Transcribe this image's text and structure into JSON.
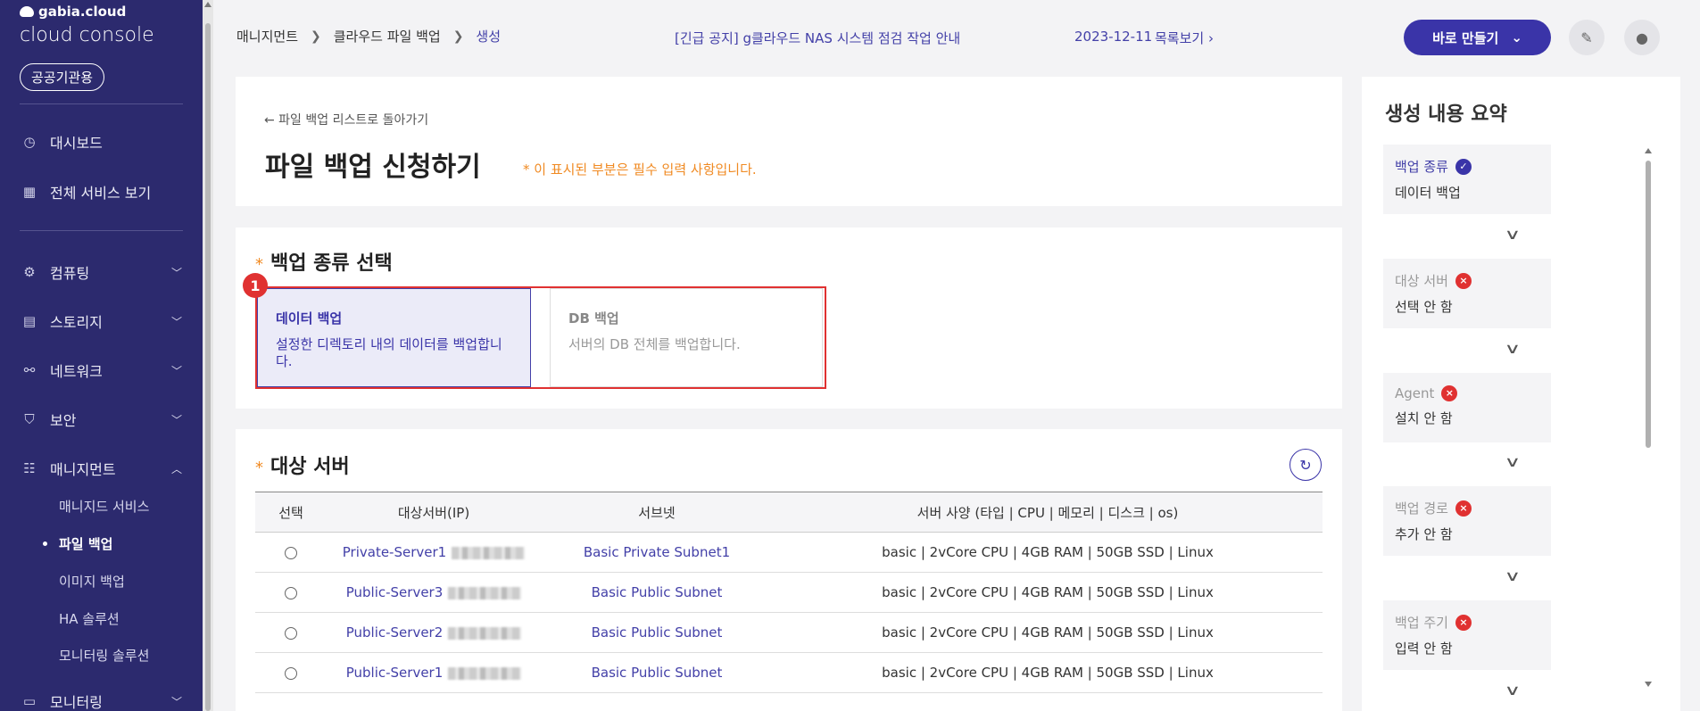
{
  "sidebar": {
    "brand_small": "gabia.cloud",
    "brand_big": "cloud console",
    "public_label": "공공기관용",
    "items": [
      {
        "label": "대시보드",
        "icon": "dashboard-icon"
      },
      {
        "label": "전체 서비스 보기",
        "icon": "grid-icon"
      },
      {
        "label": "컴퓨팅",
        "icon": "cpu-icon"
      },
      {
        "label": "스토리지",
        "icon": "storage-icon"
      },
      {
        "label": "네트워크",
        "icon": "network-icon"
      },
      {
        "label": "보안",
        "icon": "shield-icon"
      },
      {
        "label": "매니지먼트",
        "icon": "management-icon"
      },
      {
        "label": "모니터링",
        "icon": "monitor-icon"
      }
    ],
    "sub_items": [
      "매니지드 서비스",
      "파일 백업",
      "이미지 백업",
      "HA 솔루션",
      "모니터링 솔루션"
    ]
  },
  "header": {
    "breadcrumb": [
      "매니지먼트",
      "클라우드 파일 백업",
      "생성"
    ],
    "notice": "[긴급 공지] g클라우드 NAS 시스템 점검 작업 안내",
    "notice_date": "2023-12-11",
    "notice_list": "목록보기",
    "quick_create": "바로 만들기"
  },
  "page": {
    "back_link": "← 파일 백업 리스트로 돌아가기",
    "title": "파일 백업 신청하기",
    "required_note": "* 이 표시된 부분은 필수 입력 사항입니다."
  },
  "backup_type": {
    "title": "백업 종류 선택",
    "badge": "1",
    "options": [
      {
        "title": "데이터 백업",
        "desc": "설정한 디렉토리 내의 데이터를 백업합니다."
      },
      {
        "title": "DB 백업",
        "desc": "서버의 DB 전체를 백업합니다."
      }
    ]
  },
  "target_server": {
    "title": "대상 서버",
    "columns": [
      "선택",
      "대상서버(IP)",
      "서브넷",
      "서버 사양 (타입 | CPU | 메모리 | 디스크 | os)"
    ],
    "rows": [
      {
        "server": "Private-Server1",
        "subnet": "Basic Private Subnet1",
        "spec": "basic | 2vCore CPU | 4GB RAM | 50GB SSD | Linux"
      },
      {
        "server": "Public-Server3",
        "subnet": "Basic Public Subnet",
        "spec": "basic | 2vCore CPU | 4GB RAM | 50GB SSD | Linux"
      },
      {
        "server": "Public-Server2",
        "subnet": "Basic Public Subnet",
        "spec": "basic | 2vCore CPU | 4GB RAM | 50GB SSD | Linux"
      },
      {
        "server": "Public-Server1",
        "subnet": "Basic Public Subnet",
        "spec": "basic | 2vCore CPU | 4GB RAM | 50GB SSD | Linux"
      }
    ]
  },
  "summary": {
    "title": "생성 내용 요약",
    "items": [
      {
        "label": "백업 종류",
        "value": "데이터 백업",
        "done": true
      },
      {
        "label": "대상 서버",
        "value": "선택 안 함",
        "done": false
      },
      {
        "label": "Agent",
        "value": "설치 안 함",
        "done": false
      },
      {
        "label": "백업 경로",
        "value": "추가 안 함",
        "done": false
      },
      {
        "label": "백업 주기",
        "value": "입력 안 함",
        "done": false
      }
    ]
  },
  "colors": {
    "primary": "#3a34a8",
    "sidebar": "#2c2a6e",
    "accent": "#f08a22",
    "error": "#e03131"
  }
}
